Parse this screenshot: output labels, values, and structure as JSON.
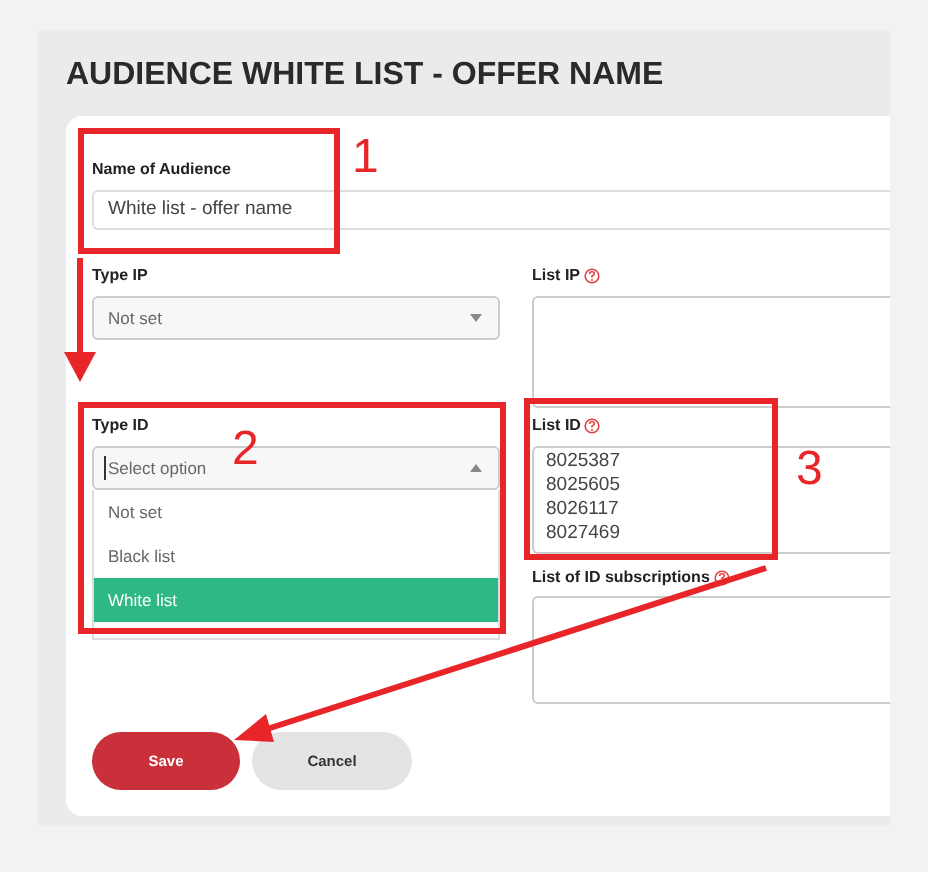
{
  "title": "AUDIENCE WHITE LIST - OFFER NAME",
  "name_field": {
    "label": "Name of Audience",
    "value": "White list - offer name"
  },
  "type_ip": {
    "label": "Type IP",
    "value": "Not set",
    "expanded": false
  },
  "list_ip": {
    "label": "List IP"
  },
  "type_id": {
    "label": "Type ID",
    "placeholder": "Select option",
    "expanded": true,
    "options": [
      {
        "label": "Not set",
        "selected": false
      },
      {
        "label": "Black list",
        "selected": false
      },
      {
        "label": "White list",
        "selected": true
      }
    ]
  },
  "list_id": {
    "label": "List ID",
    "lines": [
      "8025387",
      "8025605",
      "8026117",
      "8027469"
    ]
  },
  "list_id_subscriptions": {
    "label": "List of ID subscriptions"
  },
  "buttons": [
    {
      "label": "Save",
      "kind": "primary"
    },
    {
      "label": "Cancel",
      "kind": "secondary"
    }
  ],
  "annotations": [
    {
      "label": "1"
    },
    {
      "label": "2"
    },
    {
      "label": "3"
    }
  ]
}
